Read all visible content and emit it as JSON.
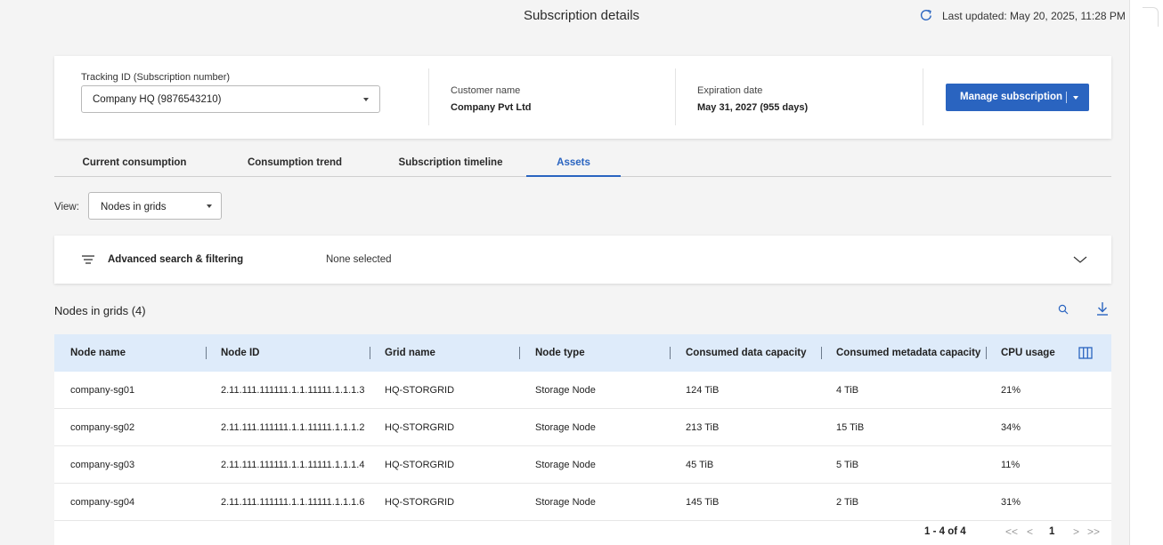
{
  "header": {
    "title": "Subscription details",
    "last_updated": "Last updated: May 20, 2025, 11:28 PM"
  },
  "summary": {
    "tracking_label": "Tracking ID (Subscription number)",
    "tracking_value": "Company HQ (9876543210)",
    "customer_label": "Customer name",
    "customer_value": "Company Pvt Ltd",
    "expiration_label": "Expiration date",
    "expiration_value": "May 31, 2027 (955 days)",
    "manage_button": "Manage subscription"
  },
  "tabs": [
    {
      "label": "Current consumption"
    },
    {
      "label": "Consumption trend"
    },
    {
      "label": "Subscription timeline"
    },
    {
      "label": "Assets",
      "active": true
    }
  ],
  "view": {
    "label": "View:",
    "value": "Nodes in grids"
  },
  "filter": {
    "label": "Advanced search & filtering",
    "selection": "None selected"
  },
  "table": {
    "title": "Nodes in grids (4)",
    "columns": [
      "Node name",
      "Node ID",
      "Grid name",
      "Node type",
      "Consumed data capacity",
      "Consumed metadata capacity",
      "CPU usage"
    ],
    "rows": [
      [
        "company-sg01",
        "2.11.111.111111.1.1.11111.1.1.1.3",
        "HQ-STORGRID",
        "Storage Node",
        "124 TiB",
        "4 TiB",
        "21%"
      ],
      [
        "company-sg02",
        "2.11.111.111111.1.1.11111.1.1.1.2",
        "HQ-STORGRID",
        "Storage Node",
        "213 TiB",
        "15 TiB",
        "34%"
      ],
      [
        "company-sg03",
        "2.11.111.111111.1.1.11111.1.1.1.4",
        "HQ-STORGRID",
        "Storage Node",
        "45 TiB",
        "5 TiB",
        "11%"
      ],
      [
        "company-sg04",
        "2.11.111.111111.1.1.11111.1.1.1.6",
        "HQ-STORGRID",
        "Storage Node",
        "145 TiB",
        "2 TiB",
        "31%"
      ]
    ]
  },
  "pagination": {
    "range": "1 - 4 of 4",
    "first": "<<",
    "prev": "<",
    "page": "1",
    "next": ">",
    "last": ">>"
  },
  "colors": {
    "accent": "#2a64c0",
    "header_row": "#deebfa",
    "background": "#f4f4f4"
  },
  "icons": [
    "refresh-icon",
    "chevron-down-icon",
    "filter-lines-icon",
    "search-icon",
    "download-icon",
    "columns-icon"
  ]
}
